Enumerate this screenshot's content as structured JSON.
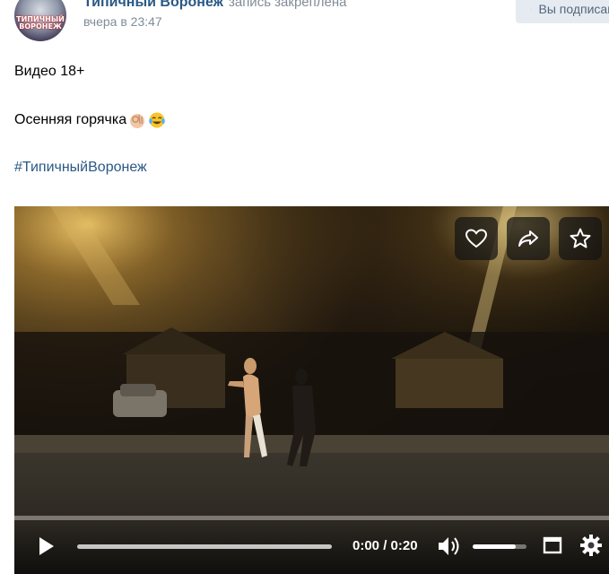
{
  "post": {
    "author": "Типичный Воронеж",
    "pinned_label": "запись закреплена",
    "time": "вчера в 23:47",
    "subscribed_label": "Вы подписаны",
    "avatar_text": "ТИПИЧНЫЙ ВОРОНЕЖ",
    "lines": [
      "Видео 18+",
      "Осенняя горячка",
      "#ТипичныйВоронеж"
    ],
    "emojis": [
      "ok-hand-emoji",
      "tears-of-joy-emoji"
    ]
  },
  "video": {
    "time_display": "0:00 / 0:20",
    "progress": 0.0,
    "volume": 0.8,
    "actions": [
      "like-icon",
      "share-icon",
      "bookmark-icon"
    ]
  },
  "colors": {
    "link": "#2a5885",
    "meta": "#818c99",
    "button_bg": "#e5ebf1",
    "button_text": "#55677d"
  }
}
